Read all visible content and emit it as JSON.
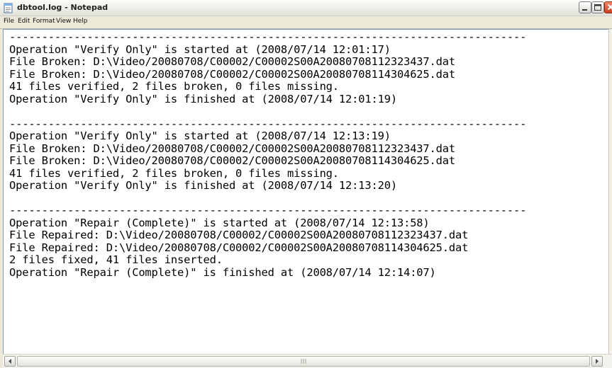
{
  "window": {
    "title": "dbtool.log - Notepad"
  },
  "menu": {
    "items": [
      "File",
      "Edit",
      "Format",
      "View",
      "Help"
    ]
  },
  "document": {
    "lines": [
      "--------------------------------------------------------------------------------",
      "Operation \"Verify Only\" is started at (2008/07/14 12:01:17)",
      "File Broken: D:\\Video/20080708/C00002/C00002S00A20080708112323437.dat",
      "File Broken: D:\\Video/20080708/C00002/C00002S00A20080708114304625.dat",
      "41 files verified, 2 files broken, 0 files missing.",
      "Operation \"Verify Only\" is finished at (2008/07/14 12:01:19)",
      "",
      "--------------------------------------------------------------------------------",
      "Operation \"Verify Only\" is started at (2008/07/14 12:13:19)",
      "File Broken: D:\\Video/20080708/C00002/C00002S00A20080708112323437.dat",
      "File Broken: D:\\Video/20080708/C00002/C00002S00A20080708114304625.dat",
      "41 files verified, 2 files broken, 0 files missing.",
      "Operation \"Verify Only\" is finished at (2008/07/14 12:13:20)",
      "",
      "--------------------------------------------------------------------------------",
      "Operation \"Repair (Complete)\" is started at (2008/07/14 12:13:58)",
      "File Repaired: D:\\Video/20080708/C00002/C00002S00A20080708112323437.dat",
      "File Repaired: D:\\Video/20080708/C00002/C00002S00A20080708114304625.dat",
      "2 files fixed, 41 files inserted.",
      "Operation \"Repair (Complete)\" is finished at (2008/07/14 12:14:07)"
    ]
  },
  "colors": {
    "window_frame": "#ece9d8",
    "edit_background": "#ffffff",
    "close_button": "#c84120"
  },
  "icons": {
    "app": "notepad-icon",
    "minimize": "minimize-icon",
    "maximize": "maximize-icon",
    "close": "close-icon",
    "scroll_left": "arrow-left-icon",
    "scroll_right": "arrow-right-icon"
  }
}
